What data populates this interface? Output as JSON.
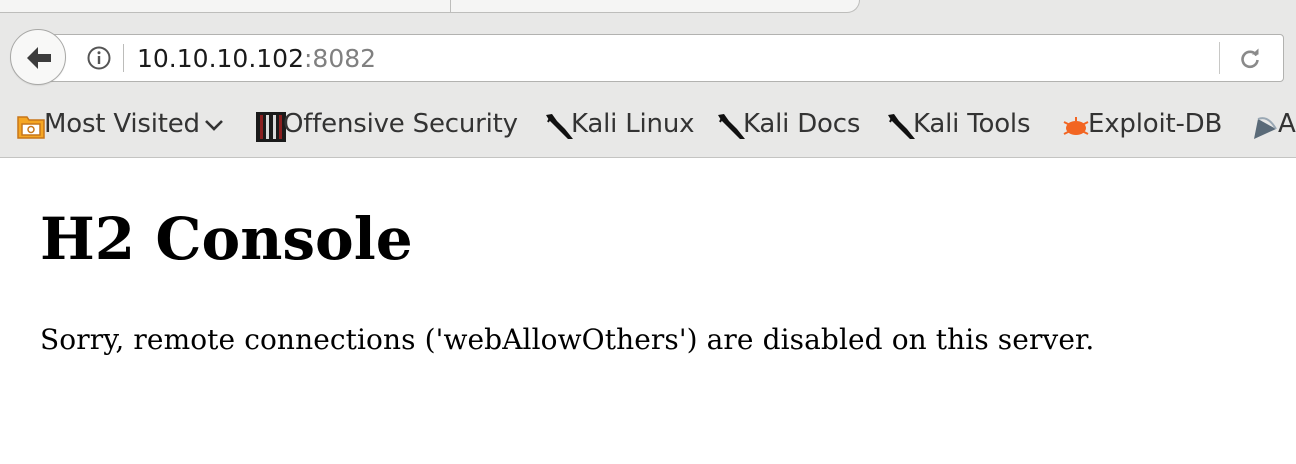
{
  "browser": {
    "address_bar": {
      "host": "10.10.10.102",
      "port": ":8082"
    },
    "bookmarks": [
      {
        "label": "Most Visited",
        "icon": "folder-icon",
        "has_dropdown": true
      },
      {
        "label": "Offensive Security",
        "icon": "offensive-security-icon"
      },
      {
        "label": "Kali Linux",
        "icon": "kali-dragon-icon"
      },
      {
        "label": "Kali Docs",
        "icon": "kali-dragon-icon"
      },
      {
        "label": "Kali Tools",
        "icon": "kali-dragon-icon"
      },
      {
        "label": "Exploit-DB",
        "icon": "exploit-db-bug-icon"
      },
      {
        "label": "A",
        "icon": "aircrack-icon"
      }
    ]
  },
  "page": {
    "title": "H2 Console",
    "message": "Sorry, remote connections ('webAllowOthers') are disabled on this server."
  },
  "colors": {
    "chrome_background": "#e8e8e7",
    "url_port": "#808080",
    "page_background": "#ffffff",
    "exploit_db_orange": "#f26522"
  }
}
